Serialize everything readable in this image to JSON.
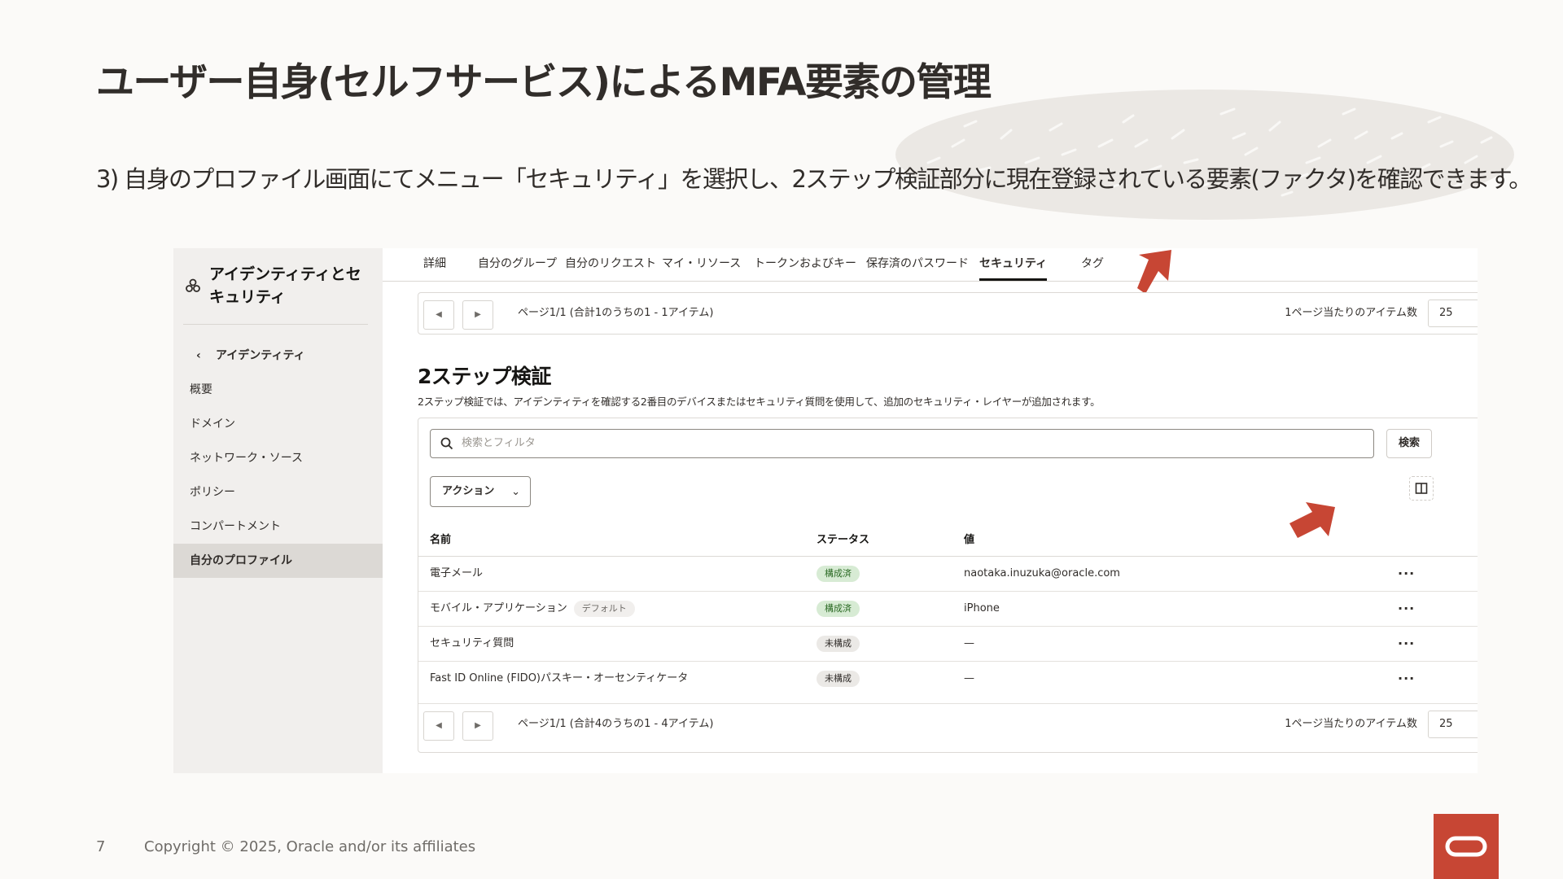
{
  "slide": {
    "title": "ユーザー自身(セルフサービス)によるMFA要素の管理",
    "subtitle": "3)  自身のプロファイル画面にてメニュー「セキュリティ」を選択し、2ステップ検証部分に現在登録されている要素(ファクタ)を確認できます。",
    "page_number": "7",
    "copyright": "Copyright © 2025, Oracle and/or its affiliates"
  },
  "colors": {
    "accent_red": "#c74634",
    "sidebar_bg": "#f1efed",
    "status_configured": "#d7ebd4"
  },
  "sidebar": {
    "title": "アイデンティティとセキュリティ",
    "icon": "identity-icon",
    "back_label": "アイデンティティ",
    "items": [
      {
        "label": "概要"
      },
      {
        "label": "ドメイン"
      },
      {
        "label": "ネットワーク・ソース"
      },
      {
        "label": "ポリシー"
      },
      {
        "label": "コンパートメント"
      },
      {
        "label": "自分のプロファイル",
        "active": true
      }
    ]
  },
  "tabs": [
    {
      "label": "詳細"
    },
    {
      "label": "自分のグループ"
    },
    {
      "label": "自分のリクエスト"
    },
    {
      "label": "マイ・リソース"
    },
    {
      "label": "トークンおよびキー"
    },
    {
      "label": "保存済のパスワード"
    },
    {
      "label": "セキュリティ",
      "active": true
    },
    {
      "label": "タグ"
    }
  ],
  "top_pager": {
    "text": "ページ1/1 (合計1のうちの1 - 1アイテム)",
    "per_page_label": "1ページ当たりのアイテム数",
    "per_page_value": "25"
  },
  "two_step": {
    "title": "2ステップ検証",
    "description": "2ステップ検証では、アイデンティティを確認する2番目のデバイスまたはセキュリティ質問を使用して、追加のセキュリティ・レイヤーが追加されます。",
    "search_placeholder": "検索とフィルタ",
    "search_button": "検索",
    "actions_button": "アクション",
    "columns": {
      "name": "名前",
      "status": "ステータス",
      "value": "値"
    },
    "rows": [
      {
        "name": "電子メール",
        "tag": "",
        "status": "構成済",
        "configured": true,
        "value": "naotaka.inuzuka@oracle.com"
      },
      {
        "name": "モバイル・アプリケーション",
        "tag": "デフォルト",
        "status": "構成済",
        "configured": true,
        "value": "iPhone"
      },
      {
        "name": "セキュリティ質問",
        "tag": "",
        "status": "未構成",
        "configured": false,
        "value": "—"
      },
      {
        "name": "Fast ID Online (FIDO)パスキー・オーセンティケータ",
        "tag": "",
        "status": "未構成",
        "configured": false,
        "value": "—"
      }
    ]
  },
  "bottom_pager": {
    "text": "ページ1/1 (合計4のうちの1 - 4アイテム)",
    "per_page_label": "1ページ当たりのアイテム数",
    "per_page_value": "25"
  }
}
